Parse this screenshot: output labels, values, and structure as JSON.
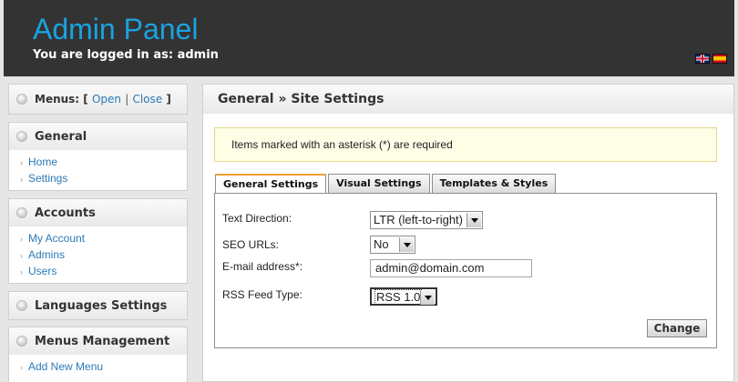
{
  "header": {
    "title": "Admin Panel",
    "logged_in": "You are logged in as: admin",
    "flags": [
      "uk-flag-icon",
      "spain-flag-icon"
    ]
  },
  "sidebar": {
    "menus": {
      "label": "Menus: [",
      "open": "Open",
      "sep": "|",
      "close": "Close",
      "end": "]"
    },
    "general": {
      "title": "General",
      "items": [
        "Home",
        "Settings"
      ]
    },
    "accounts": {
      "title": "Accounts",
      "items": [
        "My Account",
        "Admins",
        "Users"
      ]
    },
    "languages": {
      "title": "Languages Settings"
    },
    "menus_management": {
      "title": "Menus Management",
      "items": [
        "Add New Menu"
      ]
    }
  },
  "main": {
    "title": "General » Site Settings",
    "notice": "Items marked with an asterisk (*) are required",
    "tabs": [
      "General Settings",
      "Visual Settings",
      "Templates & Styles"
    ],
    "fields": {
      "text_direction": {
        "label": "Text Direction:",
        "value": "LTR (left-to-right)"
      },
      "seo_urls": {
        "label": "SEO URLs:",
        "value": "No"
      },
      "email": {
        "label": "E-mail address*:",
        "value": "admin@domain.com"
      },
      "rss": {
        "label": "RSS Feed Type:",
        "value": "RSS 1.0"
      }
    },
    "change_button": "Change"
  },
  "colors": {
    "header_bg": "#333333",
    "title": "#19a3e0",
    "link": "#2a7ab8",
    "tab_accent": "#f0a030"
  }
}
